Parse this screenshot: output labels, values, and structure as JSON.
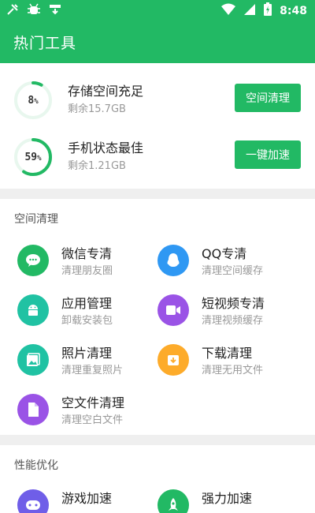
{
  "status_bar": {
    "left_icons": [
      "tools-icon",
      "bug-icon",
      "download-icon"
    ],
    "time": "8:48"
  },
  "app_bar": {
    "title": "热门工具"
  },
  "storage": {
    "rows": [
      {
        "percent": 8,
        "percent_text": "8",
        "title": "存储空间充足",
        "subtitle": "剩余15.7GB",
        "button": "空间清理",
        "ring_color": "#22b964"
      },
      {
        "percent": 59,
        "percent_text": "59",
        "title": "手机状态最佳",
        "subtitle": "剩余1.21GB",
        "button": "一键加速",
        "ring_color": "#22b964"
      }
    ],
    "percent_sign": "%"
  },
  "space_clean": {
    "title": "空间清理",
    "items": [
      {
        "name": "微信专清",
        "desc": "清理朋友圈",
        "icon": "wechat-icon",
        "color": "#22b964"
      },
      {
        "name": "QQ专清",
        "desc": "清理空间缓存",
        "icon": "qq-icon",
        "color": "#2f98f3"
      },
      {
        "name": "应用管理",
        "desc": "卸载安装包",
        "icon": "android-icon",
        "color": "#20c2a3"
      },
      {
        "name": "短视频专清",
        "desc": "清理视频缓存",
        "icon": "video-icon",
        "color": "#9a53e6"
      },
      {
        "name": "照片清理",
        "desc": "清理重复照片",
        "icon": "photo-icon",
        "color": "#20c2a3"
      },
      {
        "name": "下载清理",
        "desc": "清理无用文件",
        "icon": "download-box-icon",
        "color": "#fdab2a"
      },
      {
        "name": "空文件清理",
        "desc": "清理空白文件",
        "icon": "file-icon",
        "color": "#9a53e6"
      }
    ]
  },
  "performance": {
    "title": "性能优化",
    "items": [
      {
        "name": "游戏加速",
        "icon": "game-icon",
        "color": "#6f5ee8"
      },
      {
        "name": "强力加速",
        "icon": "rocket-icon",
        "color": "#22b964"
      }
    ]
  }
}
